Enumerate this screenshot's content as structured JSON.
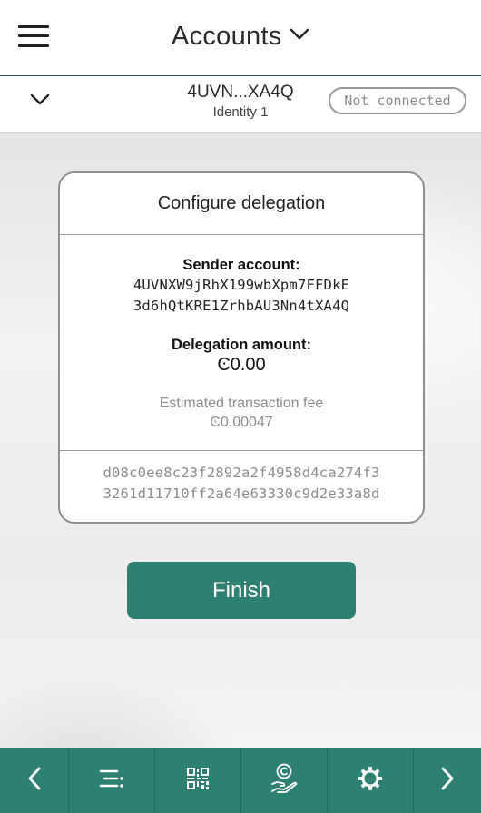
{
  "header": {
    "title": "Accounts"
  },
  "account_bar": {
    "address": "4UVN...XA4Q",
    "identity": "Identity 1",
    "connection_status": "Not connected"
  },
  "delegation_card": {
    "title": "Configure delegation",
    "sender_label": "Sender account:",
    "sender_line1": "4UVNXW9jRhX199wbXpm7FFDkE",
    "sender_line2": "3d6hQtKRE1ZrhbAU3Nn4tXA4Q",
    "amount_label": "Delegation amount:",
    "amount_value": "Ͼ0.00",
    "fee_label": "Estimated transaction fee",
    "fee_value": "Ͼ0.00047",
    "hash_line1": "d08c0ee8c23f2892a2f4958d4ca274f3",
    "hash_line2": "3261d11710ff2a64e63330c9d2e33a8d"
  },
  "finish_button": {
    "label": "Finish"
  },
  "bottom_nav": {
    "items": [
      {
        "icon": "chevron-left-icon"
      },
      {
        "icon": "transaction-list-icon"
      },
      {
        "icon": "qr-code-icon"
      },
      {
        "icon": "ccd-hand-icon"
      },
      {
        "icon": "gear-icon"
      },
      {
        "icon": "chevron-right-icon"
      }
    ]
  },
  "colors": {
    "accent": "#2e8072",
    "header_border": "#1f4e5e",
    "muted_text": "#8c8c8c"
  }
}
